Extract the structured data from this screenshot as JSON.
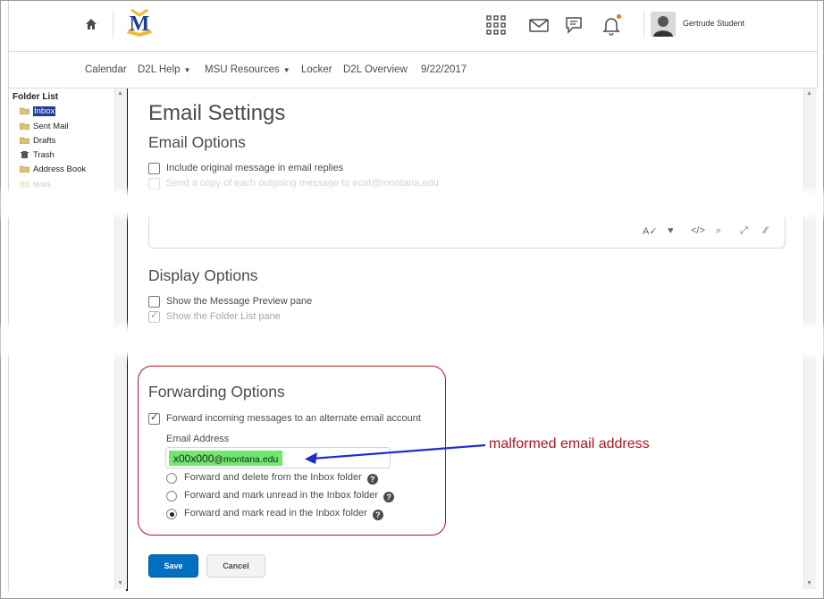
{
  "header": {
    "logo_letter": "M",
    "user_name": "Gertrude Student",
    "icons": [
      "home-icon",
      "waffle-icon",
      "mail-icon",
      "chat-icon",
      "bell-icon"
    ],
    "notification_color": "#e87511"
  },
  "nav": {
    "items": [
      "Calendar",
      "D2L Help",
      "MSU Resources",
      "Locker",
      "D2L Overview",
      "9/22/2017"
    ]
  },
  "sidebar": {
    "title": "Folder List",
    "items": [
      "Inbox",
      "Sent Mail",
      "Drafts",
      "Trash",
      "Address Book",
      "tests"
    ]
  },
  "page": {
    "title": "Email Settings",
    "email_options": {
      "heading": "Email Options",
      "include_original": "Include original message in email replies",
      "send_copy": "Send a copy of each outgoing message to ecat@montana.edu"
    },
    "display_options": {
      "heading": "Display Options",
      "preview_pane": "Show the Message Preview pane",
      "folder_list": "Show the Folder List pane"
    },
    "forwarding_options": {
      "heading": "Forwarding Options",
      "forward_label": "Forward incoming messages to an alternate email account",
      "email_label": "Email Address",
      "email_user": "x00x000",
      "email_domain": "@montana.edu",
      "opt_delete": "Forward and delete from the Inbox folder",
      "opt_unread": "Forward and mark unread in the Inbox folder",
      "opt_read": "Forward and mark read in the Inbox folder",
      "help": "?"
    },
    "save_label": "Save",
    "cancel_label": "Cancel"
  },
  "annotation": {
    "text": "malformed email address",
    "color": "#b0141e"
  },
  "colors": {
    "primary": "#006fbf",
    "highlight": "#6ee86e",
    "selection": "#1f3d99"
  }
}
